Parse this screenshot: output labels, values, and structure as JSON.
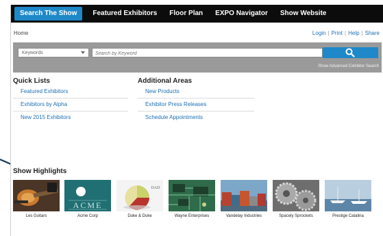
{
  "nav": {
    "tabs": [
      {
        "label": "Search The Show",
        "active": true
      },
      {
        "label": "Featured Exhibitors",
        "active": false
      },
      {
        "label": "Floor Plan",
        "active": false
      },
      {
        "label": "EXPO Navigator",
        "active": false
      },
      {
        "label": "Show Website",
        "active": false
      }
    ]
  },
  "breadcrumb": {
    "home": "Home"
  },
  "util_links": [
    "Login",
    "Print",
    "Help",
    "Share"
  ],
  "util_separator": "|",
  "search": {
    "select_value": "Keywords",
    "placeholder": "Search by Keyword",
    "advanced_link": "Show Advanced Exhibitor Search"
  },
  "quick_lists": {
    "title": "Quick Lists",
    "items": [
      "Featured Exhibitors",
      "Exhibitors by Alpha",
      "New 2015 Exhibitors"
    ]
  },
  "additional_areas": {
    "title": "Additional Areas",
    "items": [
      "New Products",
      "Exhibitor Press Releases",
      "Schedule Appointments"
    ]
  },
  "highlights": {
    "title": "Show Highlights",
    "items": [
      {
        "label": "Les Guitars",
        "icon": "guitar-image"
      },
      {
        "label": "Acme Corp",
        "icon": "acme-logo",
        "logo_text": "ACME"
      },
      {
        "label": "Duke & Duke",
        "icon": "pie-chart-image",
        "logo_text": "DAD"
      },
      {
        "label": "Wayne Enterprises",
        "icon": "circuit-board-image"
      },
      {
        "label": "Vandelay Industries",
        "icon": "shipping-containers-image"
      },
      {
        "label": "Spacely Sprockets",
        "icon": "gears-image"
      },
      {
        "label": "Prestige Catalina",
        "icon": "yacht-harbor-image"
      }
    ]
  },
  "colors": {
    "nav_bg": "#0c0c0c",
    "accent": "#1e88c9",
    "link": "#1e6fb4",
    "search_bar_bg": "#9a9a9a",
    "acme_teal": "#1f6f73"
  }
}
